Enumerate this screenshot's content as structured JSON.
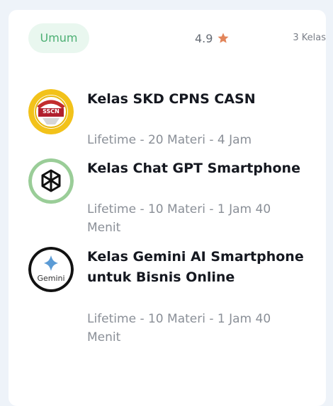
{
  "header": {
    "category": "Umum",
    "rating": "4.9",
    "count": "3 Kelas"
  },
  "courses": [
    {
      "title": "Kelas SKD CPNS CASN",
      "meta": "Lifetime - 20 Materi - 4 Jam",
      "logo_text": "SSCN",
      "logo_icon": "sscn-logo"
    },
    {
      "title": "Kelas Chat GPT Smartphone",
      "meta": "Lifetime - 10 Materi - 1 Jam 40 Menit",
      "logo_icon": "openai-logo"
    },
    {
      "title": "Kelas Gemini AI Smartphone untuk Bisnis Online",
      "meta": "Lifetime - 10 Materi - 1 Jam 40 Menit",
      "logo_text": "Gemini",
      "logo_icon": "gemini-logo"
    }
  ],
  "colors": {
    "tag_bg": "#e9f7ef",
    "tag_text": "#4caf73",
    "star": "#e2855a",
    "openai_ring": "#9acd98"
  }
}
